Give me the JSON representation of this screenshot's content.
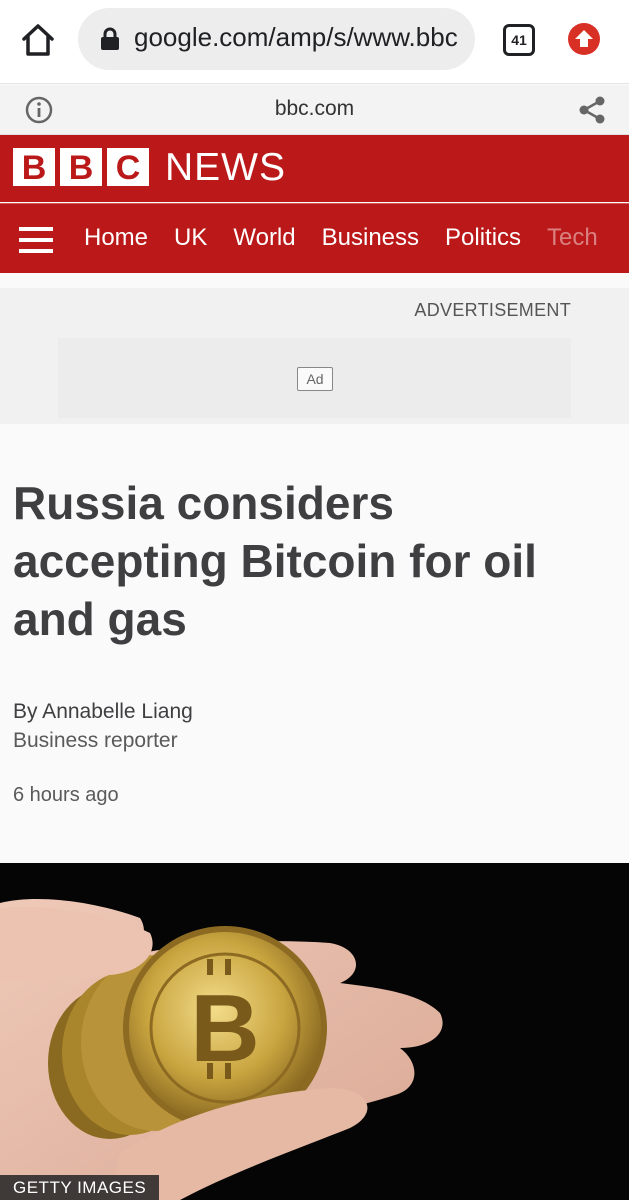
{
  "browser": {
    "url": "google.com/amp/s/www.bbc",
    "tab_count": "41",
    "icons": {
      "home": "home-icon",
      "lock": "lock-icon",
      "update": "update-arrow-icon"
    }
  },
  "amp_bar": {
    "domain": "bbc.com",
    "icons": {
      "info": "info-icon",
      "share": "share-icon"
    }
  },
  "bbc": {
    "logo_letters": [
      "B",
      "B",
      "C"
    ],
    "news_label": "NEWS",
    "brand_color": "#bb1919",
    "nav": [
      "Home",
      "UK",
      "World",
      "Business",
      "Politics",
      "Tech"
    ]
  },
  "ad": {
    "label": "ADVERTISEMENT",
    "badge": "Ad"
  },
  "article": {
    "headline": "Russia considers accepting Bitcoin for oil and gas",
    "author": "By Annabelle Liang",
    "role": "Business reporter",
    "timestamp": "6 hours ago"
  },
  "image": {
    "credit": "GETTY IMAGES"
  }
}
